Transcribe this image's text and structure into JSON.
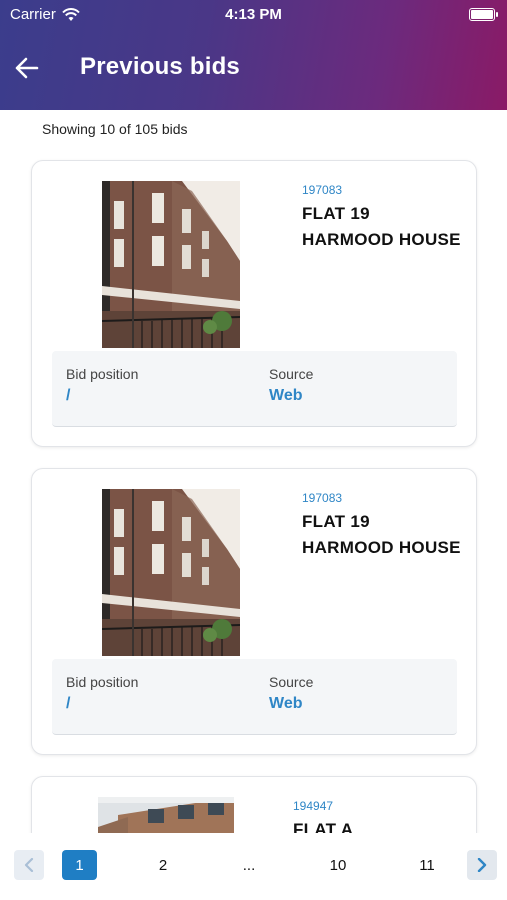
{
  "status_bar": {
    "carrier": "Carrier",
    "time": "4:13 PM"
  },
  "header": {
    "title": "Previous bids",
    "back_icon": "arrow-left-icon"
  },
  "summary": "Showing 10 of 105 bids",
  "bids": [
    {
      "ref": "197083",
      "address": "FLAT 19 HARMOOD HOUSE",
      "position_label": "Bid position",
      "position_value": "/",
      "source_label": "Source",
      "source_value": "Web"
    },
    {
      "ref": "197083",
      "address": "FLAT 19 HARMOOD HOUSE",
      "position_label": "Bid position",
      "position_value": "/",
      "source_label": "Source",
      "source_value": "Web"
    },
    {
      "ref": "194947",
      "address": "FLAT A"
    }
  ],
  "pagination": {
    "prev_icon": "chevron-left-icon",
    "next_icon": "chevron-right-icon",
    "pages": [
      "1",
      "2",
      "...",
      "10",
      "11"
    ],
    "current": "1"
  },
  "colors": {
    "accent": "#2f86c6",
    "active_page": "#1f7ec4",
    "header_start": "#3b3d8c",
    "header_end": "#8a1a66"
  }
}
